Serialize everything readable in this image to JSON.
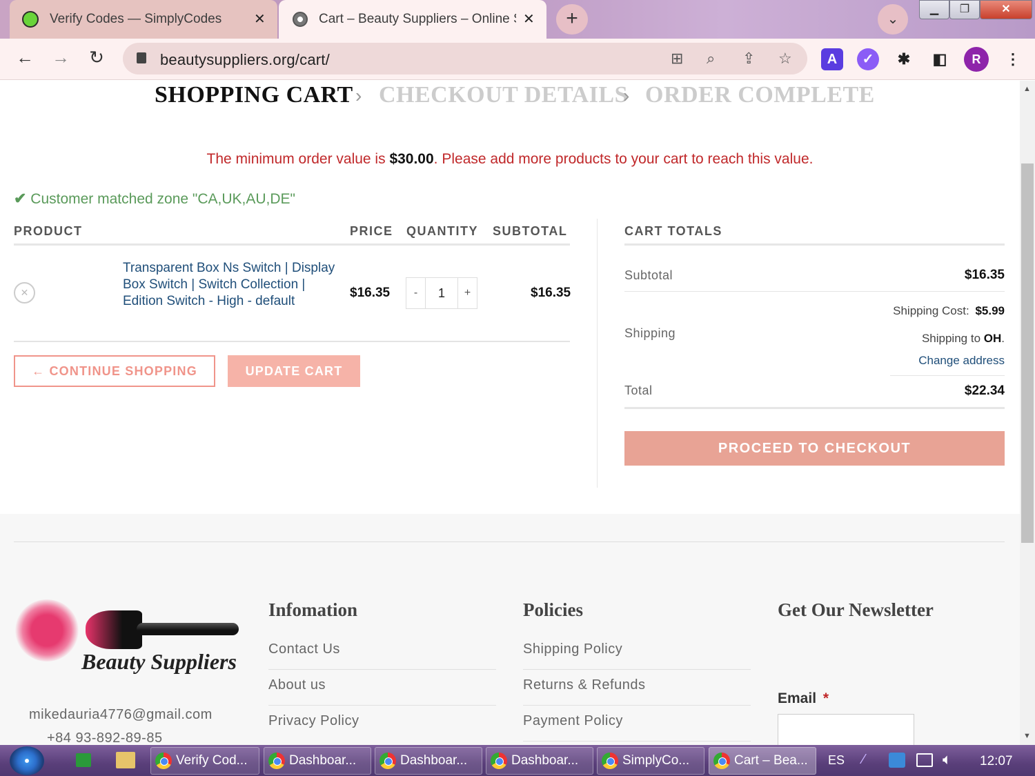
{
  "browser": {
    "tabs": [
      {
        "title": "Verify Codes — SimplyCodes",
        "icon": "simplycodes-icon"
      },
      {
        "title": "Cart – Beauty Suppliers – Online S",
        "icon": "globe-icon"
      }
    ],
    "url": "beautysuppliers.org/cart/"
  },
  "steps": {
    "current": "SHOPPING CART",
    "next": "CHECKOUT DETAILS",
    "last": "ORDER COMPLETE",
    "separator": "›"
  },
  "notice": {
    "prefix": "The minimum order value is ",
    "amount": "$30.00",
    "suffix": ". Please add more products to your cart to reach this value."
  },
  "zone_message": "Customer matched zone \"CA,UK,AU,DE\"",
  "cart": {
    "headers": {
      "product": "PRODUCT",
      "price": "PRICE",
      "quantity": "QUANTITY",
      "subtotal": "SUBTOTAL"
    },
    "item": {
      "name": "Transparent Box Ns Switch | Display Box Switch | Switch Collection | Edition Switch - High - default",
      "price": "$16.35",
      "quantity": "1",
      "subtotal": "$16.35"
    },
    "continue_label": "← CONTINUE SHOPPING",
    "update_label": "UPDATE CART"
  },
  "totals": {
    "heading": "CART TOTALS",
    "subtotal_label": "Subtotal",
    "subtotal_value": "$16.35",
    "shipping_label": "Shipping",
    "shipping_cost_label": "Shipping Cost:",
    "shipping_cost_value": "$5.99",
    "shipping_to_label": "Shipping to",
    "shipping_to_value": "OH",
    "change_address": "Change address",
    "total_label": "Total",
    "total_value": "$22.34",
    "checkout_label": "PROCEED TO CHECKOUT"
  },
  "footer": {
    "brand": "Beauty Suppliers",
    "email": "mikedauria4776@gmail.com",
    "phone": "+84 93-892-89-85",
    "info_heading": "Infomation",
    "info_links": [
      "Contact Us",
      "About us",
      "Privacy Policy"
    ],
    "policies_heading": "Policies",
    "policy_links": [
      "Shipping Policy",
      "Returns & Refunds",
      "Payment Policy"
    ],
    "newsletter_heading": "Get Our Newsletter",
    "email_label": "Email",
    "required_mark": "*"
  },
  "taskbar": {
    "buttons": [
      "Verify Cod...",
      "Dashboar...",
      "Dashboar...",
      "Dashboar...",
      "SimplyCo...",
      "Cart – Bea..."
    ],
    "language": "ES",
    "time": "12:07"
  },
  "colors": {
    "accent": "#e8a395",
    "error": "#c0282a",
    "success": "#5a9a5a",
    "link": "#1f4e79"
  }
}
